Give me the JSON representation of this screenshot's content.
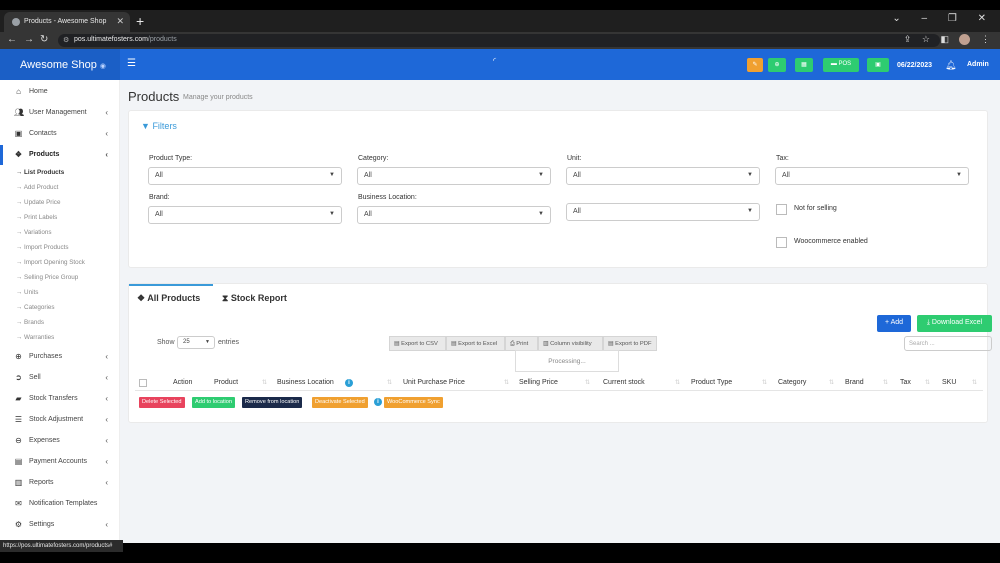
{
  "browser": {
    "tab_title": "Products - Awesome Shop",
    "url_host": "pos.ultimatefosters.com",
    "url_path": "/products",
    "status_url": "https://pos.ultimatefosters.com/products#"
  },
  "header": {
    "brand": "Awesome Shop",
    "pos_label": "POS",
    "date": "06/22/2023",
    "user": "Admin"
  },
  "sidebar": {
    "items": [
      {
        "label": "Home",
        "icon": "home-icon"
      },
      {
        "label": "User Management",
        "icon": "users-icon"
      },
      {
        "label": "Contacts",
        "icon": "contacts-icon"
      },
      {
        "label": "Products",
        "icon": "cubes-icon"
      },
      {
        "label": "Purchases",
        "icon": "plus-circle-icon"
      },
      {
        "label": "Sell",
        "icon": "arrow-circle-icon"
      },
      {
        "label": "Stock Transfers",
        "icon": "truck-icon"
      },
      {
        "label": "Stock Adjustment",
        "icon": "database-icon"
      },
      {
        "label": "Expenses",
        "icon": "minus-circle-icon"
      },
      {
        "label": "Payment Accounts",
        "icon": "money-icon"
      },
      {
        "label": "Reports",
        "icon": "chart-icon"
      },
      {
        "label": "Notification Templates",
        "icon": "envelope-icon"
      },
      {
        "label": "Settings",
        "icon": "gear-icon"
      }
    ],
    "products_sub": [
      "→ List Products",
      "→ Add Product",
      "→ Update Price",
      "→ Print Labels",
      "→ Variations",
      "→ Import Products",
      "→ Import Opening Stock",
      "→ Selling Price Group",
      "→ Units",
      "→ Categories",
      "→ Brands",
      "→ Warranties"
    ]
  },
  "page": {
    "title": "Products",
    "subtitle": "Manage your products"
  },
  "filters": {
    "heading": "Filters",
    "product_type": {
      "label": "Product Type:",
      "value": "All"
    },
    "category": {
      "label": "Category:",
      "value": "All"
    },
    "unit": {
      "label": "Unit:",
      "value": "All"
    },
    "tax": {
      "label": "Tax:",
      "value": "All"
    },
    "brand": {
      "label": "Brand:",
      "value": "All"
    },
    "business_location": {
      "label": "Business Location:",
      "value": "All"
    },
    "extra_select": {
      "value": "All"
    },
    "not_for_selling": "Not for selling",
    "woocommerce_enabled": "Woocommerce enabled"
  },
  "tabs": {
    "all_products": "All Products",
    "stock_report": "Stock Report"
  },
  "table": {
    "add_label": "Add",
    "download_excel": "Download Excel",
    "show_label": "Show",
    "entries_label": "entries",
    "page_size": "25",
    "search_placeholder": "Search ...",
    "export_buttons": [
      "Export to CSV",
      "Export to Excel",
      "Print",
      "Column visibility",
      "Export to PDF"
    ],
    "processing": "Processing...",
    "columns": [
      "Action",
      "Product",
      "Business Location",
      "Unit Purchase Price",
      "Selling Price",
      "Current stock",
      "Product Type",
      "Category",
      "Brand",
      "Tax",
      "SKU"
    ],
    "bulk_actions": [
      "Delete Selected",
      "Add to location",
      "Remove from location",
      "Deactivate Selected",
      "WooCommerce Sync"
    ]
  },
  "colors": {
    "header_blue": "#1e68d8",
    "accent_blue": "#3a9ad9",
    "green": "#2ecc71",
    "orange": "#f0a030",
    "red": "#e8435d",
    "navy": "#1b2a4a"
  }
}
